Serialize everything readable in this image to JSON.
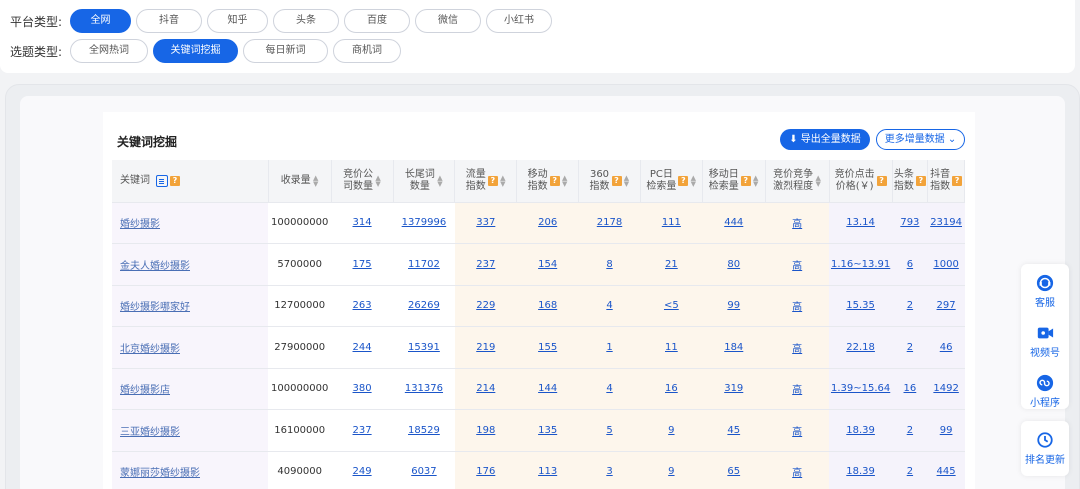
{
  "filters": {
    "platform_label": "平台类型:",
    "platforms": [
      "全网",
      "抖音",
      "知乎",
      "头条",
      "百度",
      "微信",
      "小红书"
    ],
    "platform_active": 0,
    "topic_label": "选题类型:",
    "topics": [
      "全网热词",
      "关键词挖掘",
      "每日新词",
      "商机词"
    ],
    "topic_active": 1
  },
  "panel": {
    "title": "关键词挖掘",
    "export_label": "导出全量数据",
    "more_label": "更多增量数据"
  },
  "table": {
    "headers": {
      "keyword": "关键词",
      "shoulu_1": "收录量",
      "jingjia_1": "竞价公",
      "jingjia_2": "司数量",
      "changwei_1": "长尾词",
      "changwei_2": "数量",
      "liuliang_1": "流量",
      "liuliang_2": "指数",
      "yidong_1": "移动",
      "yidong_2": "指数",
      "s360_1": "360",
      "s360_2": "指数",
      "pc_1": "PC日",
      "pc_2": "检索量",
      "mobile_1": "移动日",
      "mobile_2": "检索量",
      "compete_1": "竞价竞争",
      "compete_2": "激烈程度",
      "click_1": "竞价点击",
      "click_2": "价格(￥)",
      "toutiao_1": "头条",
      "toutiao_2": "指数",
      "douyin_1": "抖音",
      "douyin_2": "指数"
    },
    "rows": [
      {
        "keyword": "婚纱摄影",
        "shoulu": "100000000",
        "jingjia": "314",
        "changwei": "1379996",
        "liuliang": "337",
        "yidong": "206",
        "s360": "2178",
        "pc": "111",
        "mobile": "444",
        "compete": "高",
        "click": "13.14",
        "toutiao": "793",
        "douyin": "23194"
      },
      {
        "keyword": "金夫人婚纱摄影",
        "shoulu": "5700000",
        "jingjia": "175",
        "changwei": "11702",
        "liuliang": "237",
        "yidong": "154",
        "s360": "8",
        "pc": "21",
        "mobile": "80",
        "compete": "高",
        "click": "1.16~13.91",
        "toutiao": "6",
        "douyin": "1000"
      },
      {
        "keyword": "婚纱摄影哪家好",
        "shoulu": "12700000",
        "jingjia": "263",
        "changwei": "26269",
        "liuliang": "229",
        "yidong": "168",
        "s360": "4",
        "pc": "<5",
        "mobile": "99",
        "compete": "高",
        "click": "15.35",
        "toutiao": "2",
        "douyin": "297"
      },
      {
        "keyword": "北京婚纱摄影",
        "shoulu": "27900000",
        "jingjia": "244",
        "changwei": "15391",
        "liuliang": "219",
        "yidong": "155",
        "s360": "1",
        "pc": "11",
        "mobile": "184",
        "compete": "高",
        "click": "22.18",
        "toutiao": "2",
        "douyin": "46"
      },
      {
        "keyword": "婚纱摄影店",
        "shoulu": "100000000",
        "jingjia": "380",
        "changwei": "131376",
        "liuliang": "214",
        "yidong": "144",
        "s360": "4",
        "pc": "16",
        "mobile": "319",
        "compete": "高",
        "click": "1.39~15.64",
        "toutiao": "16",
        "douyin": "1492"
      },
      {
        "keyword": "三亚婚纱摄影",
        "shoulu": "16100000",
        "jingjia": "237",
        "changwei": "18529",
        "liuliang": "198",
        "yidong": "135",
        "s360": "5",
        "pc": "9",
        "mobile": "45",
        "compete": "高",
        "click": "18.39",
        "toutiao": "2",
        "douyin": "99"
      },
      {
        "keyword": "蒙娜丽莎婚纱摄影",
        "shoulu": "4090000",
        "jingjia": "249",
        "changwei": "6037",
        "liuliang": "176",
        "yidong": "113",
        "s360": "3",
        "pc": "9",
        "mobile": "65",
        "compete": "高",
        "click": "18.39",
        "toutiao": "2",
        "douyin": "445"
      }
    ]
  },
  "float_bar": {
    "items": [
      "客服",
      "视频号",
      "小程序"
    ],
    "update_label": "排名更新"
  },
  "colors": {
    "primary": "#1766e6",
    "help_badge": "#f2a33a",
    "row_keyword_bg": "#f8f5fc",
    "cream_bg": "#fdf6ec"
  }
}
